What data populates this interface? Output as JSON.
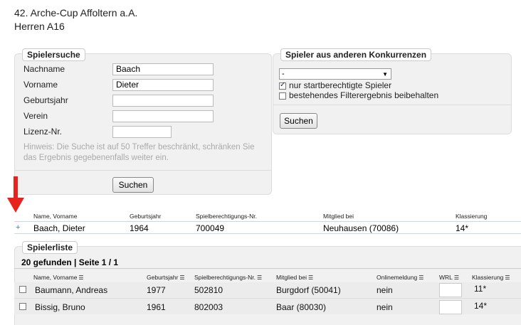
{
  "page": {
    "title_line1": "42. Arche-Cup Affoltern a.A.",
    "title_line2": "Herren A16"
  },
  "search": {
    "legend": "Spielersuche",
    "fields": [
      {
        "label": "Nachname",
        "value": "Baach"
      },
      {
        "label": "Vorname",
        "value": "Dieter"
      },
      {
        "label": "Geburtsjahr",
        "value": ""
      },
      {
        "label": "Verein",
        "value": ""
      },
      {
        "label": "Lizenz-Nr.",
        "value": ""
      }
    ],
    "hint": "Hinweis: Die Suche ist auf 50 Treffer beschränkt, schränken Sie das Ergebnis gegebenenfalls weiter ein.",
    "button": "Suchen"
  },
  "other": {
    "legend": "Spieler aus anderen Konkurrenzen",
    "select_value": "-",
    "checkbox1": {
      "label": "nur startberechtigte Spieler",
      "checked": true
    },
    "checkbox2": {
      "label": "bestehendes Filterergebnis beibehalten",
      "checked": false
    },
    "button": "Suchen"
  },
  "selected": {
    "headers": [
      "Name, Vorname",
      "Geburtsjahr",
      "Spielberechtigungs-Nr.",
      "Mitglied bei",
      "Klassierung"
    ],
    "marker": "+",
    "row": [
      "Baach, Dieter",
      "1964",
      "700049",
      "Neuhausen (70086)",
      "14*"
    ]
  },
  "list": {
    "legend": "Spielerliste",
    "summary": "20 gefunden | Seite 1 / 1",
    "headers": [
      "Name, Vorname",
      "Geburtsjahr",
      "Spielberechtigungs-Nr.",
      "Mitglied bei",
      "Onlinemeldung",
      "WRL",
      "Klassierung"
    ],
    "sort_icon": "☰",
    "rows": [
      {
        "name": "Baumann, Andreas",
        "year": "1977",
        "nr": "502810",
        "club": "Burgdorf (50041)",
        "online": "nein",
        "class": "11*"
      },
      {
        "name": "Bissig, Bruno",
        "year": "1961",
        "nr": "802003",
        "club": "Baar (80030)",
        "online": "nein",
        "class": "14*"
      }
    ]
  },
  "colors": {
    "arrow": "#e8231d",
    "panel": "#f1f1f1",
    "marker": "#3a78c6"
  }
}
